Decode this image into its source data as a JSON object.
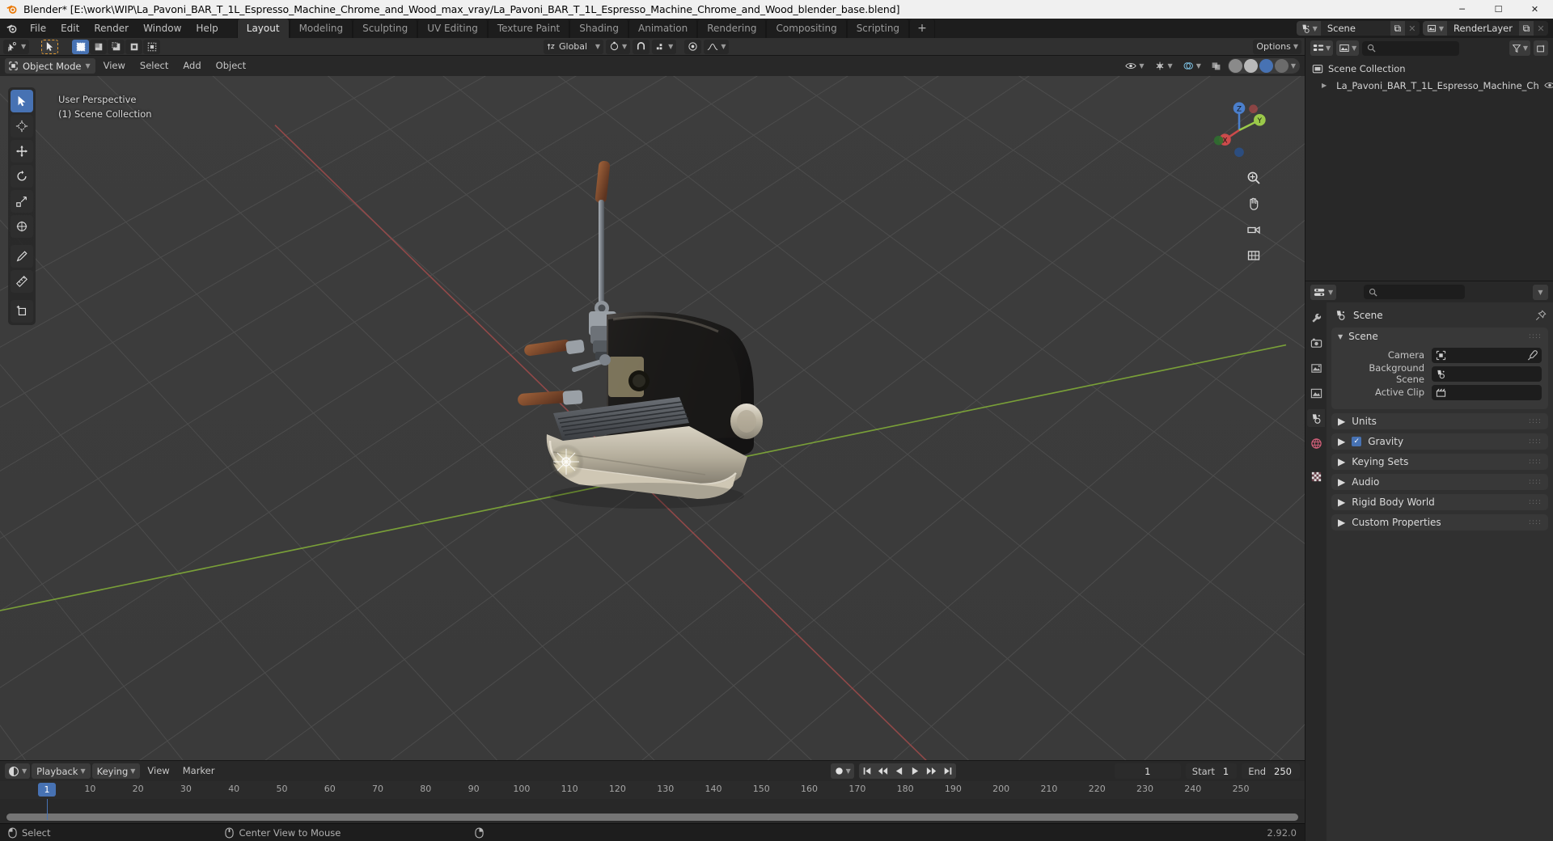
{
  "window": {
    "title": "Blender* [E:\\work\\WIP\\La_Pavoni_BAR_T_1L_Espresso_Machine_Chrome_and_Wood_max_vray/La_Pavoni_BAR_T_1L_Espresso_Machine_Chrome_and_Wood_blender_base.blend]",
    "minimize": "─",
    "maximize": "☐",
    "close": "✕"
  },
  "topbar": {
    "menus": [
      "File",
      "Edit",
      "Render",
      "Window",
      "Help"
    ],
    "workspaces": [
      {
        "label": "Layout",
        "active": true
      },
      {
        "label": "Modeling",
        "active": false
      },
      {
        "label": "Sculpting",
        "active": false
      },
      {
        "label": "UV Editing",
        "active": false
      },
      {
        "label": "Texture Paint",
        "active": false
      },
      {
        "label": "Shading",
        "active": false
      },
      {
        "label": "Animation",
        "active": false
      },
      {
        "label": "Rendering",
        "active": false
      },
      {
        "label": "Compositing",
        "active": false
      },
      {
        "label": "Scripting",
        "active": false
      }
    ],
    "add_workspace": "+",
    "scene_name": "Scene",
    "viewlayer_name": "RenderLayer",
    "new_button": "⧉",
    "unlink_button": "✕"
  },
  "toolsettings": {
    "transform_orientation": "Global",
    "options_label": "Options",
    "snap_icon": "magnet-icon",
    "proportional_icon": "proportional-edit-icon"
  },
  "viewport_header": {
    "mode": "Object Mode",
    "menus": [
      "View",
      "Select",
      "Add",
      "Object"
    ]
  },
  "viewport": {
    "overlay_line1": "User Perspective",
    "overlay_line2": "(1) Scene Collection",
    "gizmo_axes": [
      {
        "label": "X",
        "color": "#cc4b4b"
      },
      {
        "label": "Y",
        "color": "#9bc94a"
      },
      {
        "label": "Z",
        "color": "#4b7fcc"
      }
    ],
    "tools": [
      "tweak-select-tool",
      "cursor-tool",
      "move-tool",
      "rotate-tool",
      "scale-tool",
      "transform-tool",
      "annotate-tool",
      "measure-tool",
      "add-cube-tool"
    ]
  },
  "outliner": {
    "display_mode": "View Layer",
    "search_placeholder": "",
    "rows": [
      {
        "label": "Scene Collection",
        "indent": 0,
        "icon": "collection-icon",
        "expandable": false
      },
      {
        "label": "La_Pavoni_BAR_T_1L_Espresso_Machine_Ch",
        "indent": 1,
        "icon": "mesh-data-icon",
        "expandable": true
      }
    ]
  },
  "properties": {
    "breadcrumb": "Scene",
    "tabs": [
      {
        "name": "tool-tab",
        "active": false
      },
      {
        "name": "render-tab",
        "active": false
      },
      {
        "name": "output-tab",
        "active": false
      },
      {
        "name": "view-layer-tab",
        "active": false
      },
      {
        "name": "scene-tab",
        "active": true
      },
      {
        "name": "world-tab",
        "active": false
      },
      {
        "name": "texture-tab",
        "active": false
      }
    ],
    "panels": [
      {
        "title": "Scene",
        "open": true,
        "rows": [
          {
            "label": "Camera",
            "value": "",
            "field_icon": "camera-icon",
            "has_eyedropper": true
          },
          {
            "label": "Background Scene",
            "value": "",
            "field_icon": "scene-icon",
            "has_eyedropper": false
          },
          {
            "label": "Active Clip",
            "value": "",
            "field_icon": "clip-icon",
            "has_eyedropper": false
          }
        ]
      },
      {
        "title": "Units",
        "open": false,
        "rows": []
      },
      {
        "title": "Gravity",
        "open": false,
        "checkbox": true,
        "checked": true,
        "rows": []
      },
      {
        "title": "Keying Sets",
        "open": false,
        "rows": []
      },
      {
        "title": "Audio",
        "open": false,
        "rows": []
      },
      {
        "title": "Rigid Body World",
        "open": false,
        "rows": []
      },
      {
        "title": "Custom Properties",
        "open": false,
        "rows": []
      }
    ]
  },
  "timeline": {
    "menus": [
      "Playback",
      "Keying",
      "View",
      "Marker"
    ],
    "current_frame": "1",
    "current_frame_marker": "1",
    "start_label": "Start",
    "start_value": "1",
    "end_label": "End",
    "end_value": "250",
    "ticks": [
      10,
      20,
      30,
      40,
      50,
      60,
      70,
      80,
      90,
      100,
      110,
      120,
      130,
      140,
      150,
      160,
      170,
      180,
      190,
      200,
      210,
      220,
      230,
      240,
      250
    ],
    "transport": [
      "jump-start",
      "prev-keyframe",
      "play-reverse",
      "play",
      "next-keyframe",
      "jump-end"
    ]
  },
  "statusbar": {
    "items": [
      {
        "icon": "mouse-left-icon",
        "label": "Select"
      },
      {
        "icon": "mouse-middle-icon",
        "label": "Center View to Mouse"
      },
      {
        "icon": "mouse-right-icon",
        "label": ""
      }
    ],
    "version": "2.92.0"
  },
  "colors": {
    "accent": "#4772b3",
    "header": "#282828",
    "panel": "#383838",
    "viewport_bg": "#3b3b3b",
    "axis_x": "#9b4a4a",
    "axis_y": "#7ca438"
  }
}
